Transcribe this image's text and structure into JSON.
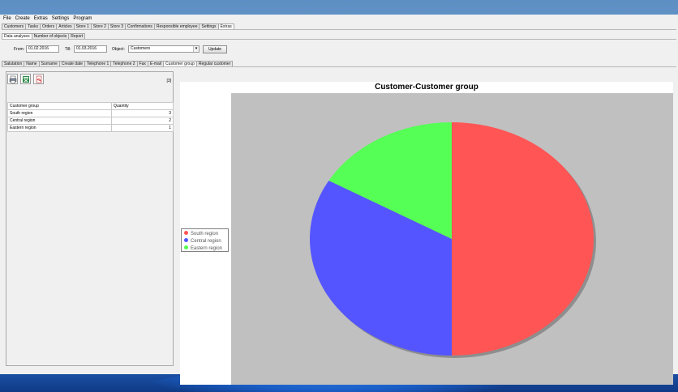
{
  "menu": [
    "File",
    "Create",
    "Extras",
    "Settings",
    "Program"
  ],
  "main_tabs": [
    "Customers",
    "Tasks",
    "Orders",
    "Articles",
    "Store 1",
    "Store 2",
    "Store 3",
    "Confirmations",
    "Responsible employee",
    "Settings",
    "Extras"
  ],
  "main_tabs_active": "Extras",
  "sub_tabs": [
    "Data analyses",
    "Number of objects",
    "Report"
  ],
  "sub_tabs_active": "Data analyses",
  "form": {
    "from_label": "From:",
    "from_value": "01.02.2016",
    "till_label": "Till:",
    "till_value": "01.03.2016",
    "object_label": "Object:",
    "object_value": "Customers",
    "update_label": "Update"
  },
  "field_tabs": [
    "Salutation",
    "Name",
    "Surname",
    "Create date",
    "Telephone 1",
    "Telephone 2",
    "Fax",
    "E-mail",
    "Customer group",
    "Regular customer"
  ],
  "field_tabs_active": "Customer group",
  "toolbar": {
    "print_icon": "printer-icon",
    "excel_icon": "excel-export-icon",
    "pdf_icon": "pdf-export-icon",
    "count": "[3]"
  },
  "table": {
    "headers": [
      "Customer group",
      "Quantity"
    ],
    "rows": [
      [
        "South region",
        "3"
      ],
      [
        "Central region",
        "2"
      ],
      [
        "Eastern region",
        "1"
      ]
    ]
  },
  "chart_data": {
    "type": "pie",
    "title": "Customer-Customer group",
    "categories": [
      "South region",
      "Central region",
      "Eastern region"
    ],
    "values": [
      3,
      2,
      1
    ],
    "colors": [
      "#ff5555",
      "#5555ff",
      "#55ff55"
    ],
    "legend": "left"
  }
}
